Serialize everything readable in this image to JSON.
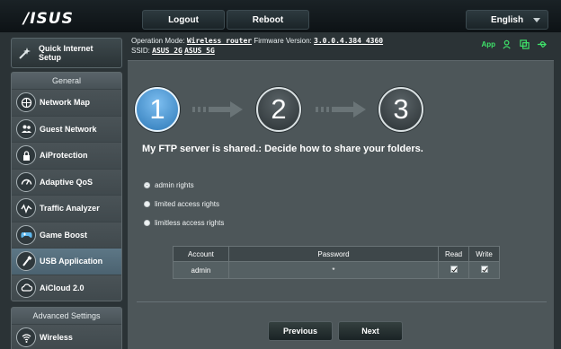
{
  "header": {
    "logo": "/ISUS",
    "logout_label": "Logout",
    "reboot_label": "Reboot",
    "language_label": "English"
  },
  "info": {
    "op_mode_label": "Operation Mode:",
    "op_mode_value": "Wireless router",
    "fw_label": "Firmware Version:",
    "fw_value": "3.0.0.4.384_4360",
    "ssid_label": "SSID:",
    "ssid_2g": "ASUS_2G",
    "ssid_5g": "ASUS_5G",
    "app_label": "App"
  },
  "sidebar": {
    "quick_setup_line1": "Quick Internet",
    "quick_setup_line2": "Setup",
    "general_label": "General",
    "items": [
      {
        "label": "Network Map",
        "icon": "network-map-icon"
      },
      {
        "label": "Guest Network",
        "icon": "guest-network-icon"
      },
      {
        "label": "AiProtection",
        "icon": "lock-icon"
      },
      {
        "label": "Adaptive QoS",
        "icon": "gauge-icon"
      },
      {
        "label": "Traffic Analyzer",
        "icon": "analyzer-icon"
      },
      {
        "label": "Game Boost",
        "icon": "gamepad-icon"
      },
      {
        "label": "USB Application",
        "icon": "usb-icon"
      },
      {
        "label": "AiCloud 2.0",
        "icon": "cloud-icon"
      }
    ],
    "active_index": 6,
    "advanced_label": "Advanced Settings",
    "advanced_items": [
      {
        "label": "Wireless",
        "icon": "wifi-icon"
      }
    ]
  },
  "wizard": {
    "steps": [
      "1",
      "2",
      "3"
    ],
    "active_step": 1,
    "heading": "My FTP server is shared.: Decide how to share your folders.",
    "options": [
      {
        "label": "admin rights",
        "checked": true
      },
      {
        "label": "limited access rights",
        "checked": false
      },
      {
        "label": "limitless access rights",
        "checked": false
      }
    ],
    "table": {
      "headers": [
        "Account",
        "Password",
        "Read",
        "Write"
      ],
      "rows": [
        {
          "account": "admin",
          "password": "*",
          "read": true,
          "write": true
        }
      ]
    },
    "previous_label": "Previous",
    "next_label": "Next"
  },
  "colors": {
    "background": "#2b3336",
    "panel": "#4d5659",
    "active_step": "#3b8fd6",
    "active_nav": "#5d7786",
    "status_green": "#3fe36a"
  }
}
